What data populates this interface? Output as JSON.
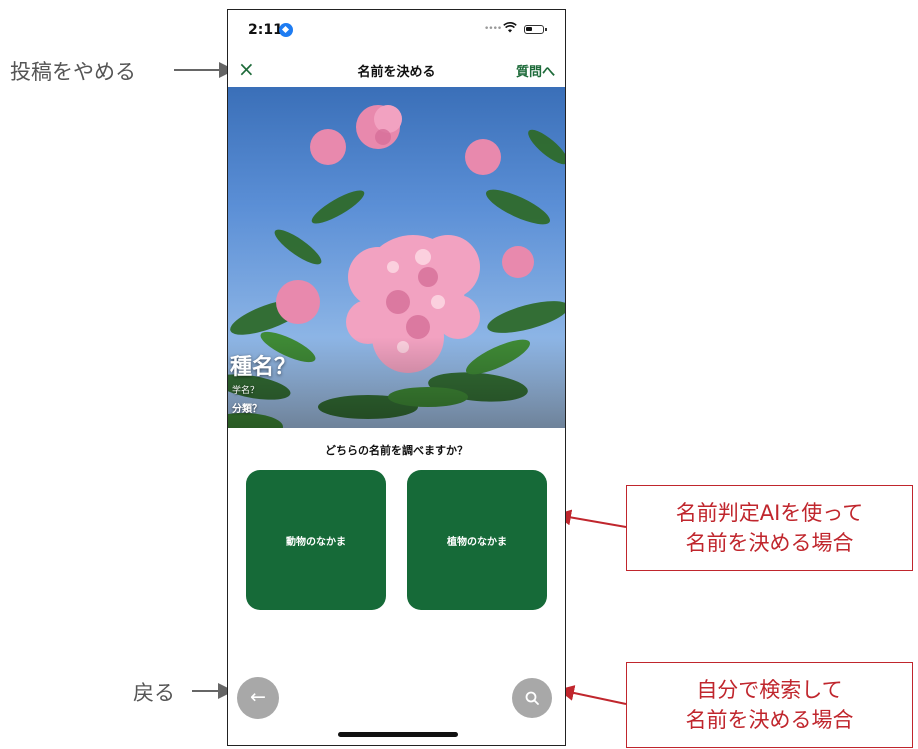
{
  "status_bar": {
    "time": "2:11"
  },
  "navbar": {
    "close_icon": "×",
    "title": "名前を決める",
    "next_label": "質問へ"
  },
  "photo": {
    "species": "種名？",
    "scientific_name": "学名？",
    "taxonomy": "分類？"
  },
  "question": "どちらの名前を調べますか？",
  "choices": {
    "animals": "動物のなかま",
    "plants": "植物のなかま"
  },
  "bottom": {
    "back_icon": "←",
    "search_icon": "search-icon"
  },
  "annotations": {
    "cancel_post": "投稿をやめる",
    "back": "戻る",
    "ai_callout_line1": "名前判定AIを使って",
    "ai_callout_line2": "名前を決める場合",
    "search_callout_line1": "自分で検索して",
    "search_callout_line2": "名前を決める場合"
  },
  "colors": {
    "accent_green": "#1e6b3a",
    "button_green": "#166a38",
    "callout_red": "#c0262d",
    "ios_blue": "#1e7cf2"
  }
}
